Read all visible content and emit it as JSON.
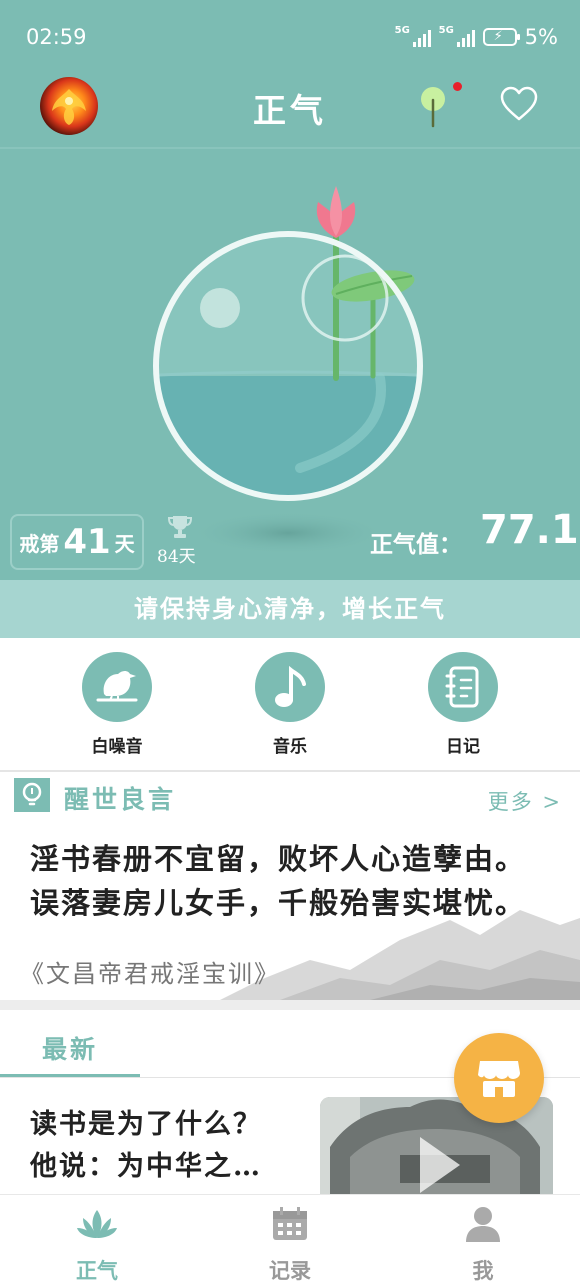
{
  "status_bar": {
    "time": "02:59",
    "signal1_label": "5G",
    "signal2_label": "5G",
    "battery_percent": "5%"
  },
  "header": {
    "title": "正气",
    "avatar_icon": "phoenix-avatar",
    "tree_icon": "tree-icon",
    "favorite_icon": "heart-icon",
    "notification_dot_color": "#e8212b"
  },
  "stats": {
    "streak_prefix": "戒第",
    "streak_days": "41",
    "streak_suffix": "天",
    "best_record": "84天",
    "zhengqi_label": "正气值：",
    "zhengqi_value": "77.1"
  },
  "banner": {
    "text": "请保持身心清净，增长正气"
  },
  "shortcuts": [
    {
      "label": "白噪音",
      "icon": "bird-icon"
    },
    {
      "label": "音乐",
      "icon": "music-note-icon"
    },
    {
      "label": "日记",
      "icon": "diary-icon"
    }
  ],
  "quote": {
    "heading": "醒世良言",
    "more": "更多 >",
    "lines": [
      "淫书春册不宜留，败坏人心造孽由。",
      "误落妻房儿女手，千般殆害实堪忧。"
    ],
    "source": "《文昌帝君戒淫宝训》"
  },
  "latest": {
    "tab_label": "最新",
    "article_title_lines": [
      "读书是为了什么？",
      "他说：为中华之…"
    ]
  },
  "bottom_nav": [
    {
      "label": "正气",
      "icon": "lotus-icon",
      "active": true
    },
    {
      "label": "记录",
      "icon": "calendar-icon",
      "active": false
    },
    {
      "label": "我",
      "icon": "person-icon",
      "active": false
    }
  ],
  "colors": {
    "accent": "#7cbcb3",
    "banner": "#a6d5d0",
    "fab": "#f5b345",
    "lotus": "#f0788f"
  }
}
